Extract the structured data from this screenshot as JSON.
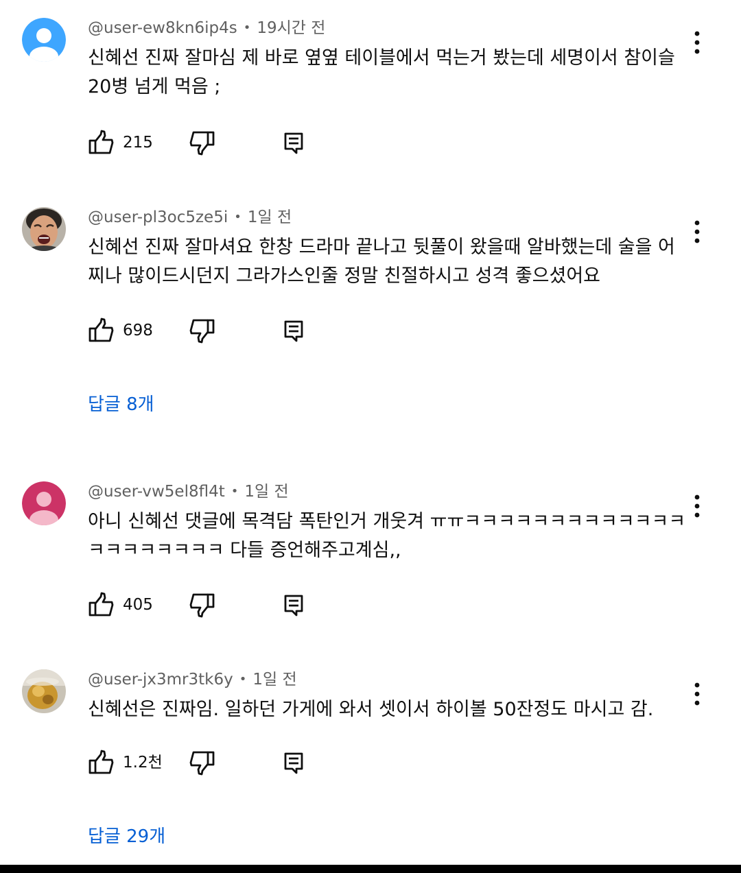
{
  "comments": [
    {
      "handle": "@user-ew8kn6ip4s",
      "time": "19시간 전",
      "avatar": "default-blue",
      "text": "신혜선 진짜 잘마심 제 바로 옆옆 테이블에서 먹는거 봤는데 세명이서 참이슬 20병 넘게 먹음 ;",
      "likes": "215"
    },
    {
      "handle": "@user-pl3oc5ze5i",
      "time": "1일 전",
      "avatar": "photo-person",
      "text": "신혜선 진짜 잘마셔요 한창 드라마 끝나고 뒷풀이 왔을때 알바했는데 술을 어찌나 많이드시던지 그라가스인줄 정말 친절하시고 성격 좋으셨어요",
      "likes": "698",
      "replies": "답글 8개"
    },
    {
      "handle": "@user-vw5el8fl4t",
      "time": "1일 전",
      "avatar": "default-pink",
      "text": "아니 신혜선 댓글에 목격담 폭탄인거 개웃겨 ㅠㅠㅋㅋㅋㅋㅋㅋㅋㅋㅋㅋㅋㅋㅋㅋㅋㅋㅋㅋㅋㅋㅋ 다들 증언해주고계심,,",
      "likes": "405"
    },
    {
      "handle": "@user-jx3mr3tk6y",
      "time": "1일 전",
      "avatar": "photo-drink",
      "text": "신혜선은 진짜임. 일하던 가게에 와서 셋이서 하이볼 50잔정도 마시고 감.",
      "likes": "1.2천",
      "replies": "답글 29개"
    }
  ],
  "icons": {
    "like": "thumbs-up-icon",
    "dislike": "thumbs-down-icon",
    "reply": "reply-comment-icon",
    "more": "more-vertical-icon"
  },
  "colors": {
    "avatar_blue": "#3ea6ff",
    "avatar_pink": "#cc3366",
    "replies_link": "#065fd4",
    "meta_text": "#606060"
  }
}
